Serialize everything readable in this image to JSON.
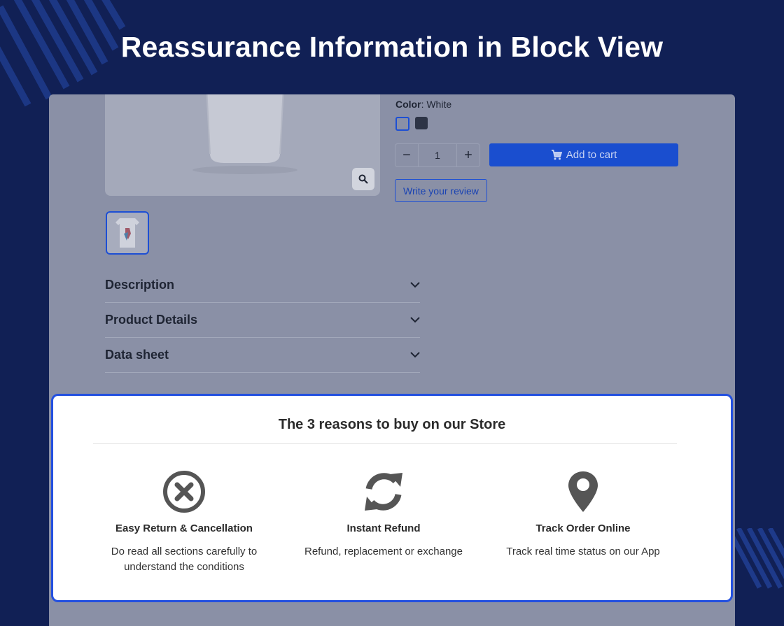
{
  "headline": "Reassurance Information in Block View",
  "product": {
    "color_label": "Color",
    "color_value": "White",
    "swatches": [
      "White",
      "Black"
    ],
    "quantity": "1",
    "add_to_cart": "Add to cart",
    "write_review": "Write your review"
  },
  "accordion": [
    {
      "label": "Description"
    },
    {
      "label": "Product Details"
    },
    {
      "label": "Data sheet"
    }
  ],
  "reassurance": {
    "title": "The 3 reasons to buy on our Store",
    "items": [
      {
        "icon": "close-circle-icon",
        "title": "Easy Return & Cancellation",
        "desc": "Do read all sections carefully to understand the conditions"
      },
      {
        "icon": "refresh-icon",
        "title": "Instant Refund",
        "desc": "Refund, replacement or exchange"
      },
      {
        "icon": "location-pin-icon",
        "title": "Track Order Online",
        "desc": "Track real time status on our App"
      }
    ]
  },
  "colors": {
    "background": "#112055",
    "accent": "#2350e0",
    "cart_button": "#1a4ecf"
  }
}
